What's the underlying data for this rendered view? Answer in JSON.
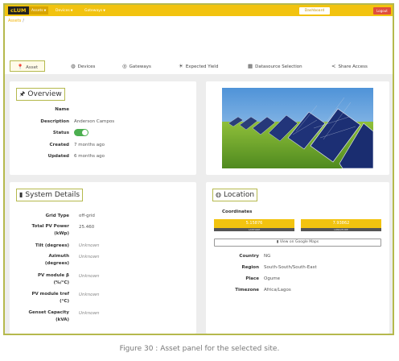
{
  "topbar": {
    "logo": "cLUM",
    "nav": [
      {
        "label": "Assets",
        "active": true
      },
      {
        "label": "Devices",
        "active": false
      },
      {
        "label": "Gateways",
        "active": false
      }
    ],
    "dashboard_label": "Dashboard",
    "logout_label": "Logout"
  },
  "breadcrumb": {
    "root": "Assets",
    "sep": "/"
  },
  "tabs": [
    {
      "label": "Asset",
      "icon": "pin-icon",
      "active": true
    },
    {
      "label": "Devices",
      "icon": "globe-icon"
    },
    {
      "label": "Gateways",
      "icon": "gateway-icon"
    },
    {
      "label": "Expected Yield",
      "icon": "sun-icon"
    },
    {
      "label": "Datasource Selection",
      "icon": "database-icon"
    },
    {
      "label": "Share Access",
      "icon": "share-icon"
    }
  ],
  "overview": {
    "title": "Overview",
    "fields": [
      {
        "label": "Name",
        "value": ""
      },
      {
        "label": "Description",
        "value": "Anderson Campos"
      },
      {
        "label": "Status",
        "value": ""
      },
      {
        "label": "Created",
        "value": "7 months ago"
      },
      {
        "label": "Updated",
        "value": "6 months ago"
      }
    ],
    "status_on": true
  },
  "system": {
    "title": "System Details",
    "fields": [
      {
        "label": "Grid Type",
        "value": "off-grid",
        "muted": false
      },
      {
        "label": "Total PV Power (kWp)",
        "value": "25.460",
        "muted": false
      },
      {
        "label": "Tilt (degrees)",
        "value": "Unknown",
        "muted": true
      },
      {
        "label": "Azimuth (degrees)",
        "value": "Unknown",
        "muted": true
      },
      {
        "label": "PV module β (%/°C)",
        "value": "Unknown",
        "muted": true
      },
      {
        "label": "PV module tref (°C)",
        "value": "Unknown",
        "muted": true
      },
      {
        "label": "Genset Capacity (kVA)",
        "value": "Unknown",
        "muted": true
      }
    ]
  },
  "location": {
    "title": "Location",
    "coordinates_label": "Coordinates",
    "latitude": "5.15876",
    "latitude_label": "LATITUDE",
    "longitude": "7.93862",
    "longitude_label": "LONGITUDE",
    "map_button": "View on Google Maps",
    "fields": [
      {
        "label": "Country",
        "value": "NG"
      },
      {
        "label": "Region",
        "value": "South-South/South-East"
      },
      {
        "label": "Place",
        "value": "Ogume"
      },
      {
        "label": "Timezone",
        "value": "Africa/Lagos"
      }
    ]
  },
  "caption": "Figure 30 : Asset panel for the selected site.",
  "colors": {
    "accent": "#f2c30f",
    "frame": "#b5b94d",
    "status_on": "#4caf50",
    "logout": "#e04e3c"
  }
}
